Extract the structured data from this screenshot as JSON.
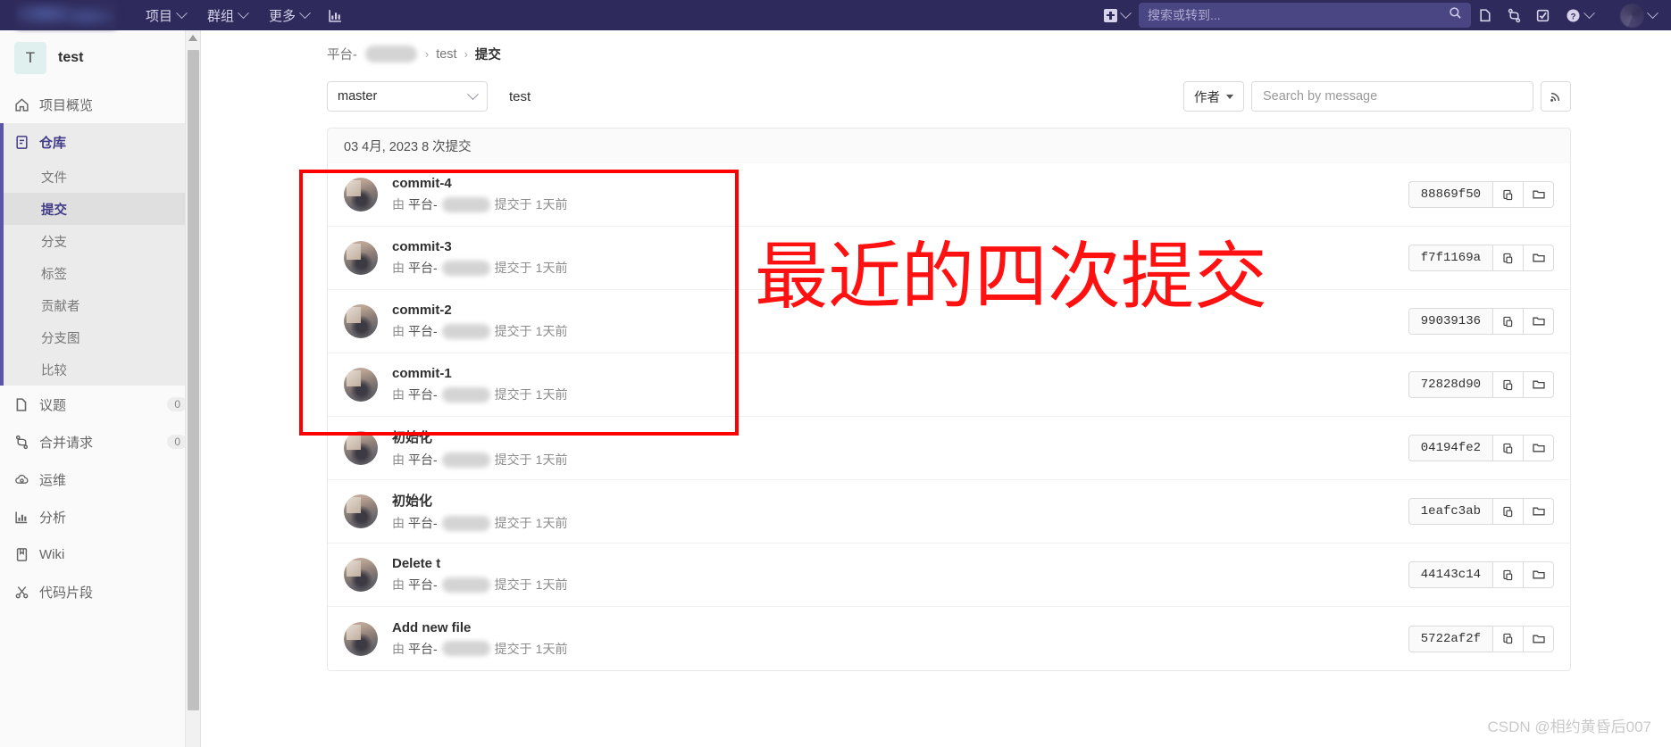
{
  "topnav": {
    "items": [
      {
        "label": "项目",
        "icon": "chevron-down-icon"
      },
      {
        "label": "群组",
        "icon": "chevron-down-icon"
      },
      {
        "label": "更多",
        "icon": "chevron-down-icon"
      }
    ],
    "analytics_icon": "chart-bar-icon",
    "new_icon": "plus-square-icon",
    "search_placeholder": "搜索或转到...",
    "right_icons": [
      "search-icon",
      "issues-icon",
      "merge-requests-icon",
      "todos-icon",
      "help-icon",
      "user-avatar"
    ]
  },
  "sidebar": {
    "project": {
      "initial": "T",
      "name": "test"
    },
    "items": [
      {
        "label": "项目概览",
        "icon": "home-icon",
        "badge": ""
      },
      {
        "label": "仓库",
        "icon": "repository-icon",
        "badge": "",
        "active": true
      },
      {
        "label": "议题",
        "icon": "issues-icon",
        "badge": "0"
      },
      {
        "label": "合并请求",
        "icon": "merge-requests-icon",
        "badge": "0"
      },
      {
        "label": "运维",
        "icon": "cloud-gear-icon",
        "badge": ""
      },
      {
        "label": "分析",
        "icon": "chart-bar-icon",
        "badge": ""
      },
      {
        "label": "Wiki",
        "icon": "book-icon",
        "badge": ""
      },
      {
        "label": "代码片段",
        "icon": "scissors-icon",
        "badge": ""
      }
    ],
    "repo_subitems": [
      {
        "label": "文件",
        "active": false
      },
      {
        "label": "提交",
        "active": true
      },
      {
        "label": "分支",
        "active": false
      },
      {
        "label": "标签",
        "active": false
      },
      {
        "label": "贡献者",
        "active": false
      },
      {
        "label": "分支图",
        "active": false
      },
      {
        "label": "比较",
        "active": false
      }
    ]
  },
  "breadcrumb": {
    "group": "平台-",
    "project": "test",
    "current": "提交",
    "separator": "›"
  },
  "filterbar": {
    "branch": "master",
    "path_label": "test",
    "author_label": "作者",
    "search_placeholder": "Search by message",
    "search_value": "",
    "rss_icon": "rss-icon"
  },
  "commits": {
    "date_header": "03 4月, 2023 8 次提交",
    "by_prefix": "由",
    "author_name": "平台-",
    "committed_text": "提交于",
    "time_ago": "1天前",
    "copy_icon": "clipboard-copy-icon",
    "browse_icon": "folder-icon",
    "rows": [
      {
        "title": "commit-4",
        "sha": "88869f50"
      },
      {
        "title": "commit-3",
        "sha": "f7f1169a"
      },
      {
        "title": "commit-2",
        "sha": "99039136"
      },
      {
        "title": "commit-1",
        "sha": "72828d90"
      },
      {
        "title": "初始化",
        "sha": "04194fe2"
      },
      {
        "title": "初始化",
        "sha": "1eafc3ab"
      },
      {
        "title": "Delete t",
        "sha": "44143c14"
      },
      {
        "title": "Add new file",
        "sha": "5722af2f"
      }
    ]
  },
  "annotations": {
    "red_text": "最近的四次提交",
    "red_color": "#ff1111",
    "watermark": "CSDN @相约黄昏后007"
  }
}
